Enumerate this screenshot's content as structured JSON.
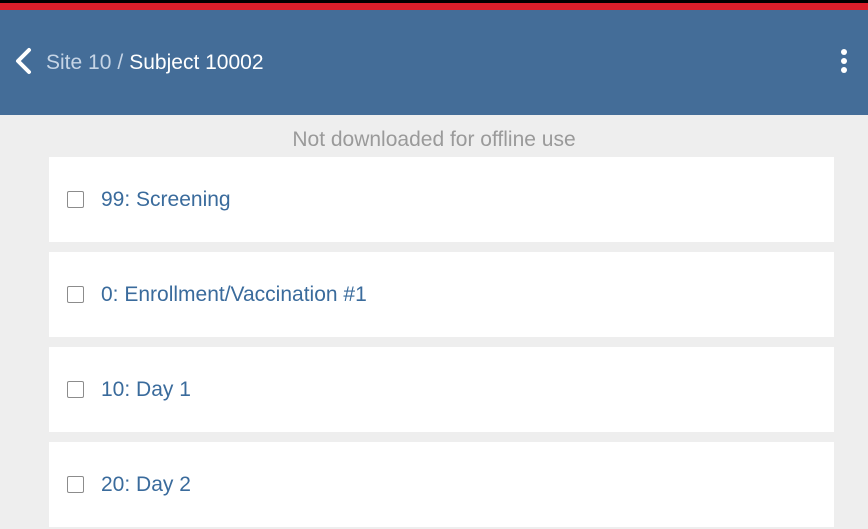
{
  "header": {
    "breadcrumb": {
      "site": "Site 10",
      "separator": "/",
      "subject": "Subject 10002"
    },
    "icons": {
      "back": "chevron-left-icon",
      "menu": "more-vertical-icon"
    },
    "background_color": "#446d98",
    "top_accent_color": "#d81e2a"
  },
  "offline_note": "Not downloaded for offline use",
  "visits": [
    {
      "label": "99: Screening",
      "checked": false
    },
    {
      "label": "0: Enrollment/Vaccination #1",
      "checked": false
    },
    {
      "label": "10: Day 1",
      "checked": false
    },
    {
      "label": "20: Day 2",
      "checked": false
    }
  ]
}
